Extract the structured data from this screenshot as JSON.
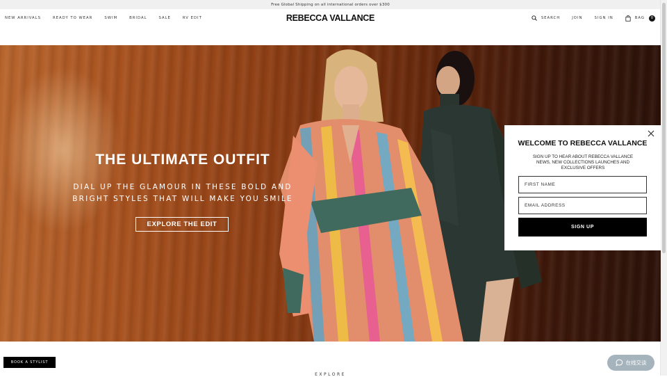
{
  "promo": {
    "text": "Free Global Shipping on all international orders over $300"
  },
  "header": {
    "nav": [
      "NEW ARRIVALS",
      "READY TO WEAR",
      "SWIM",
      "BRIDAL",
      "SALE",
      "RV EDIT"
    ],
    "logo": "REBECCA VALLANCE",
    "search_label": "SEARCH",
    "join_label": "JOIN",
    "signin_label": "SIGN IN",
    "bag_label": "BAG",
    "bag_count": "0"
  },
  "hero": {
    "title": "THE ULTIMATE OUTFIT",
    "subtitle_line1": "DIAL UP THE GLAMOUR IN THESE BOLD AND",
    "subtitle_line2": "BRIGHT STYLES THAT WILL MAKE YOU SMILE",
    "cta": "EXPLORE THE EDIT"
  },
  "modal": {
    "title": "WELCOME TO REBECCA VALLANCE",
    "description": "SIGN UP TO HEAR ABOUT REBECCA VALLANCE NEWS, NEW COLLECTIONS LAUNCHES AND EXCLUSIVE OFFERS",
    "first_name_placeholder": "FIRST NAME",
    "email_placeholder": "EMAIL ADDRESS",
    "signup_label": "SIGN UP"
  },
  "footer": {
    "stylist_label": "BOOK A STYLIST",
    "chat_label": "在线交谈",
    "explore_label": "EXPLORE"
  },
  "icons": [
    "search-icon",
    "bag-icon",
    "close-icon",
    "chat-icon"
  ],
  "colors": {
    "promo_bg": "#f0f0f0",
    "button_black": "#000000",
    "chat_bg": "#a5b3bc",
    "wood": "#a8521f"
  }
}
